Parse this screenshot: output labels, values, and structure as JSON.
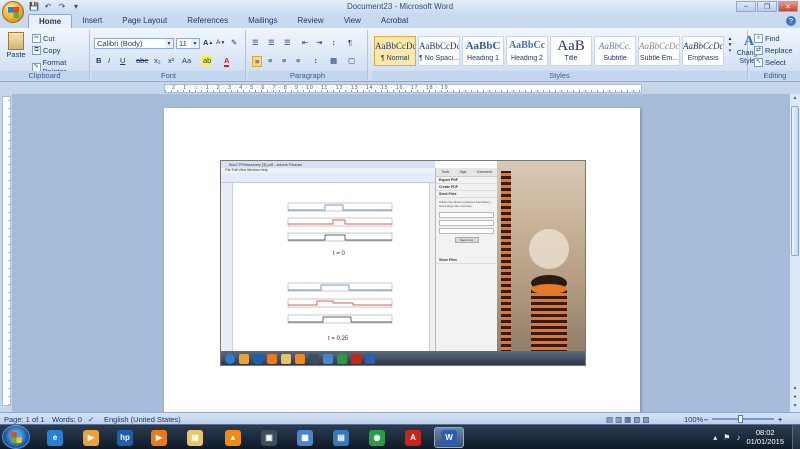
{
  "window": {
    "title": "Document23 - Microsoft Word",
    "minimize": "–",
    "maximize": "❐",
    "close": "✕"
  },
  "quick_access": [
    "💾",
    "↶",
    "↷",
    "▾"
  ],
  "tabs": [
    {
      "label": "Home",
      "active": true
    },
    {
      "label": "Insert"
    },
    {
      "label": "Page Layout"
    },
    {
      "label": "References"
    },
    {
      "label": "Mailings"
    },
    {
      "label": "Review"
    },
    {
      "label": "View"
    },
    {
      "label": "Acrobat"
    }
  ],
  "clipboard": {
    "paste": "Paste",
    "cut": "Cut",
    "copy": "Copy",
    "format_painter": "Format Painter",
    "label": "Clipboard"
  },
  "font": {
    "family": "Calibri (Body)",
    "size": "11",
    "label": "Font",
    "buttons": [
      "B",
      "I",
      "U",
      "abe",
      "x₂",
      "x²",
      "Aa"
    ],
    "grow": "A",
    "shrink": "A",
    "clear": "✎",
    "highlight": "ab",
    "color": "A"
  },
  "paragraph": {
    "label": "Paragraph",
    "top_row": [
      "☰",
      "☰",
      "☰",
      "⇤",
      "⇥",
      "↕",
      "¶"
    ],
    "bottom_row": [
      "≡",
      "≡",
      "≡",
      "≡",
      "↕",
      "▦",
      "▢"
    ]
  },
  "styles": {
    "label": "Styles",
    "items": [
      {
        "sample": "AaBbCcDc",
        "name": "¶ Normal",
        "selected": true
      },
      {
        "sample": "AaBbCcDc",
        "name": "¶ No Spaci..."
      },
      {
        "sample": "AaBbC",
        "name": "Heading 1"
      },
      {
        "sample": "AaBbCc",
        "name": "Heading 2"
      },
      {
        "sample": "AaB",
        "name": "Title"
      },
      {
        "sample": "AaBbCc.",
        "name": "Subtitle"
      },
      {
        "sample": "AaBbCcDc",
        "name": "Subtle Em..."
      },
      {
        "sample": "AaBbCcDc",
        "name": "Emphasis"
      }
    ],
    "change_styles": "Change Styles"
  },
  "editing": {
    "label": "Editing",
    "find": "Find",
    "replace": "Replace",
    "select": "Select"
  },
  "ruler": {
    "marks": "· 2 · 1 · ⌂ · 1 · 2 · 3 · 4 · 5 · 6 · 7 · 8 · 9 · 10 · 11 · 12 · 13 · 14 · 15 · 16 · 17 · 18 · 19"
  },
  "embedded": {
    "title": "BruCTPMassively [3].pdf - Adobe Reader",
    "menu": "File  Edit  View  Window  Help",
    "caption1": "t = 0",
    "caption2": "t = 0.25",
    "panel_tabs": [
      "Tools",
      "Sign",
      "Comment"
    ],
    "sections": [
      "Export PDF",
      "Create PDF",
      "Send Files"
    ],
    "body": "Adobe SendNow (replaced SendNow) – Send large files securely.",
    "button": "Send Link",
    "last_section": "Store Files"
  },
  "status": {
    "page": "Page: 1 of 1",
    "words": "Words: 0",
    "language": "English (United States)",
    "zoom": "100%",
    "zoom_minus": "–",
    "zoom_plus": "+"
  },
  "taskbar": {
    "apps": [
      {
        "name": "ie-icon",
        "color": "#2a7fd4",
        "glyph": "e"
      },
      {
        "name": "media-player-icon",
        "color": "#e8a23a",
        "glyph": "▶"
      },
      {
        "name": "hp-icon",
        "color": "#1d5fa8",
        "glyph": "hp"
      },
      {
        "name": "media-center-icon",
        "color": "#ea7a1a",
        "glyph": "▶"
      },
      {
        "name": "file-explorer-icon",
        "color": "#e8c56a",
        "glyph": "▤"
      },
      {
        "name": "vlc-icon",
        "color": "#f08a1a",
        "glyph": "▲"
      },
      {
        "name": "app-icon",
        "color": "#3d4c5e",
        "glyph": "▣"
      },
      {
        "name": "network-icon",
        "color": "#4a86c8",
        "glyph": "▦"
      },
      {
        "name": "remote-icon",
        "color": "#3a78b8",
        "glyph": "▤"
      },
      {
        "name": "chrome-icon",
        "color": "#2b9b47",
        "glyph": "◉"
      },
      {
        "name": "acrobat-icon",
        "color": "#c8261c",
        "glyph": "A"
      },
      {
        "name": "word-icon",
        "color": "#2b5fad",
        "glyph": "W"
      }
    ],
    "time": "08:02",
    "date": "01/01/2015",
    "tray_flag": "⚑",
    "tray_volume": "♪",
    "tray_arrow": "▴"
  }
}
